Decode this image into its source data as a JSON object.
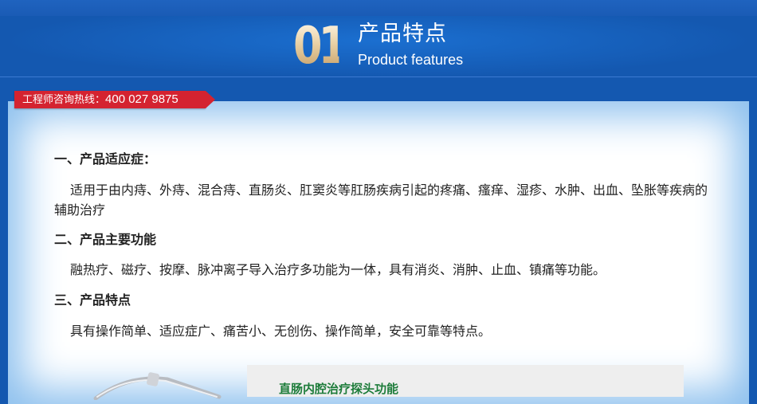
{
  "header": {
    "number": "01",
    "title_cn": "产品特点",
    "title_en": "Product features"
  },
  "hotline": {
    "label": "工程师咨询热线：",
    "number": "400 027 9875"
  },
  "sections": [
    {
      "heading": "一、产品适应症：",
      "text": "适用于由内痔、外痔、混合痔、直肠炎、肛窦炎等肛肠疾病引起的疼痛、瘙痒、湿疹、水肿、出血、坠胀等疾病的辅助治疗"
    },
    {
      "heading": "二、产品主要功能",
      "text": "融热疗、磁疗、按摩、脉冲离子导入治疗多功能为一体，具有消炎、消肿、止血、镇痛等功能。"
    },
    {
      "heading": "三、产品特点",
      "text": "具有操作简单、适应症广、痛苦小、无创伤、操作简单，安全可靠等特点。"
    }
  ],
  "probe": {
    "title": "直肠内腔治疗探头功能"
  },
  "colors": {
    "background_blue": "#1458b0",
    "hotline_red": "#d42330",
    "probe_title_green": "#1d7c3a"
  }
}
